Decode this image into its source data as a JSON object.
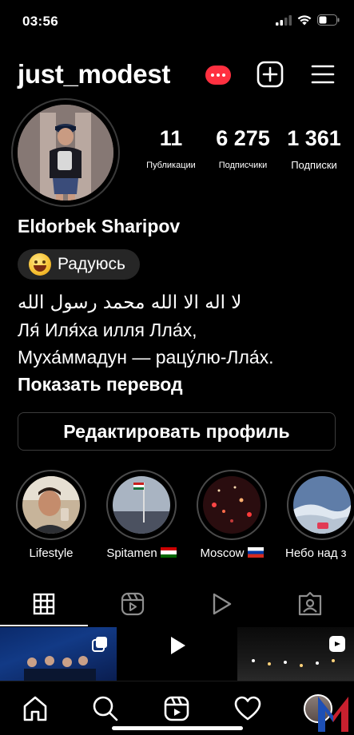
{
  "status_bar": {
    "time": "03:56"
  },
  "header": {
    "username": "just_modest"
  },
  "stats": {
    "posts": {
      "value": "11",
      "label": "Публикации"
    },
    "followers": {
      "value": "6 275",
      "label": "Подписчики"
    },
    "following": {
      "value": "1 361",
      "label": "Подписки"
    }
  },
  "profile": {
    "full_name": "Eldorbek Sharipov",
    "mood": "Радуюсь",
    "bio_lines": [
      "لا اله الا الله محمد رسول الله",
      "Ля́ Иля́ха илля Лла́х,",
      "Муха́ммадун — рацу́лю-Лла́х."
    ],
    "translate_label": "Показать перевод",
    "edit_label": "Редактировать профиль"
  },
  "highlights": [
    {
      "label": "Lifestyle"
    },
    {
      "label": "Spitamen"
    },
    {
      "label": "Moscow"
    },
    {
      "label": "Небо над з"
    }
  ],
  "tabs": [
    "grid",
    "reels",
    "videos",
    "tagged"
  ],
  "colors": {
    "background": "#000000",
    "notification": "#ff3040",
    "button_border": "#3c3c3c",
    "chip_bg": "#262626"
  }
}
